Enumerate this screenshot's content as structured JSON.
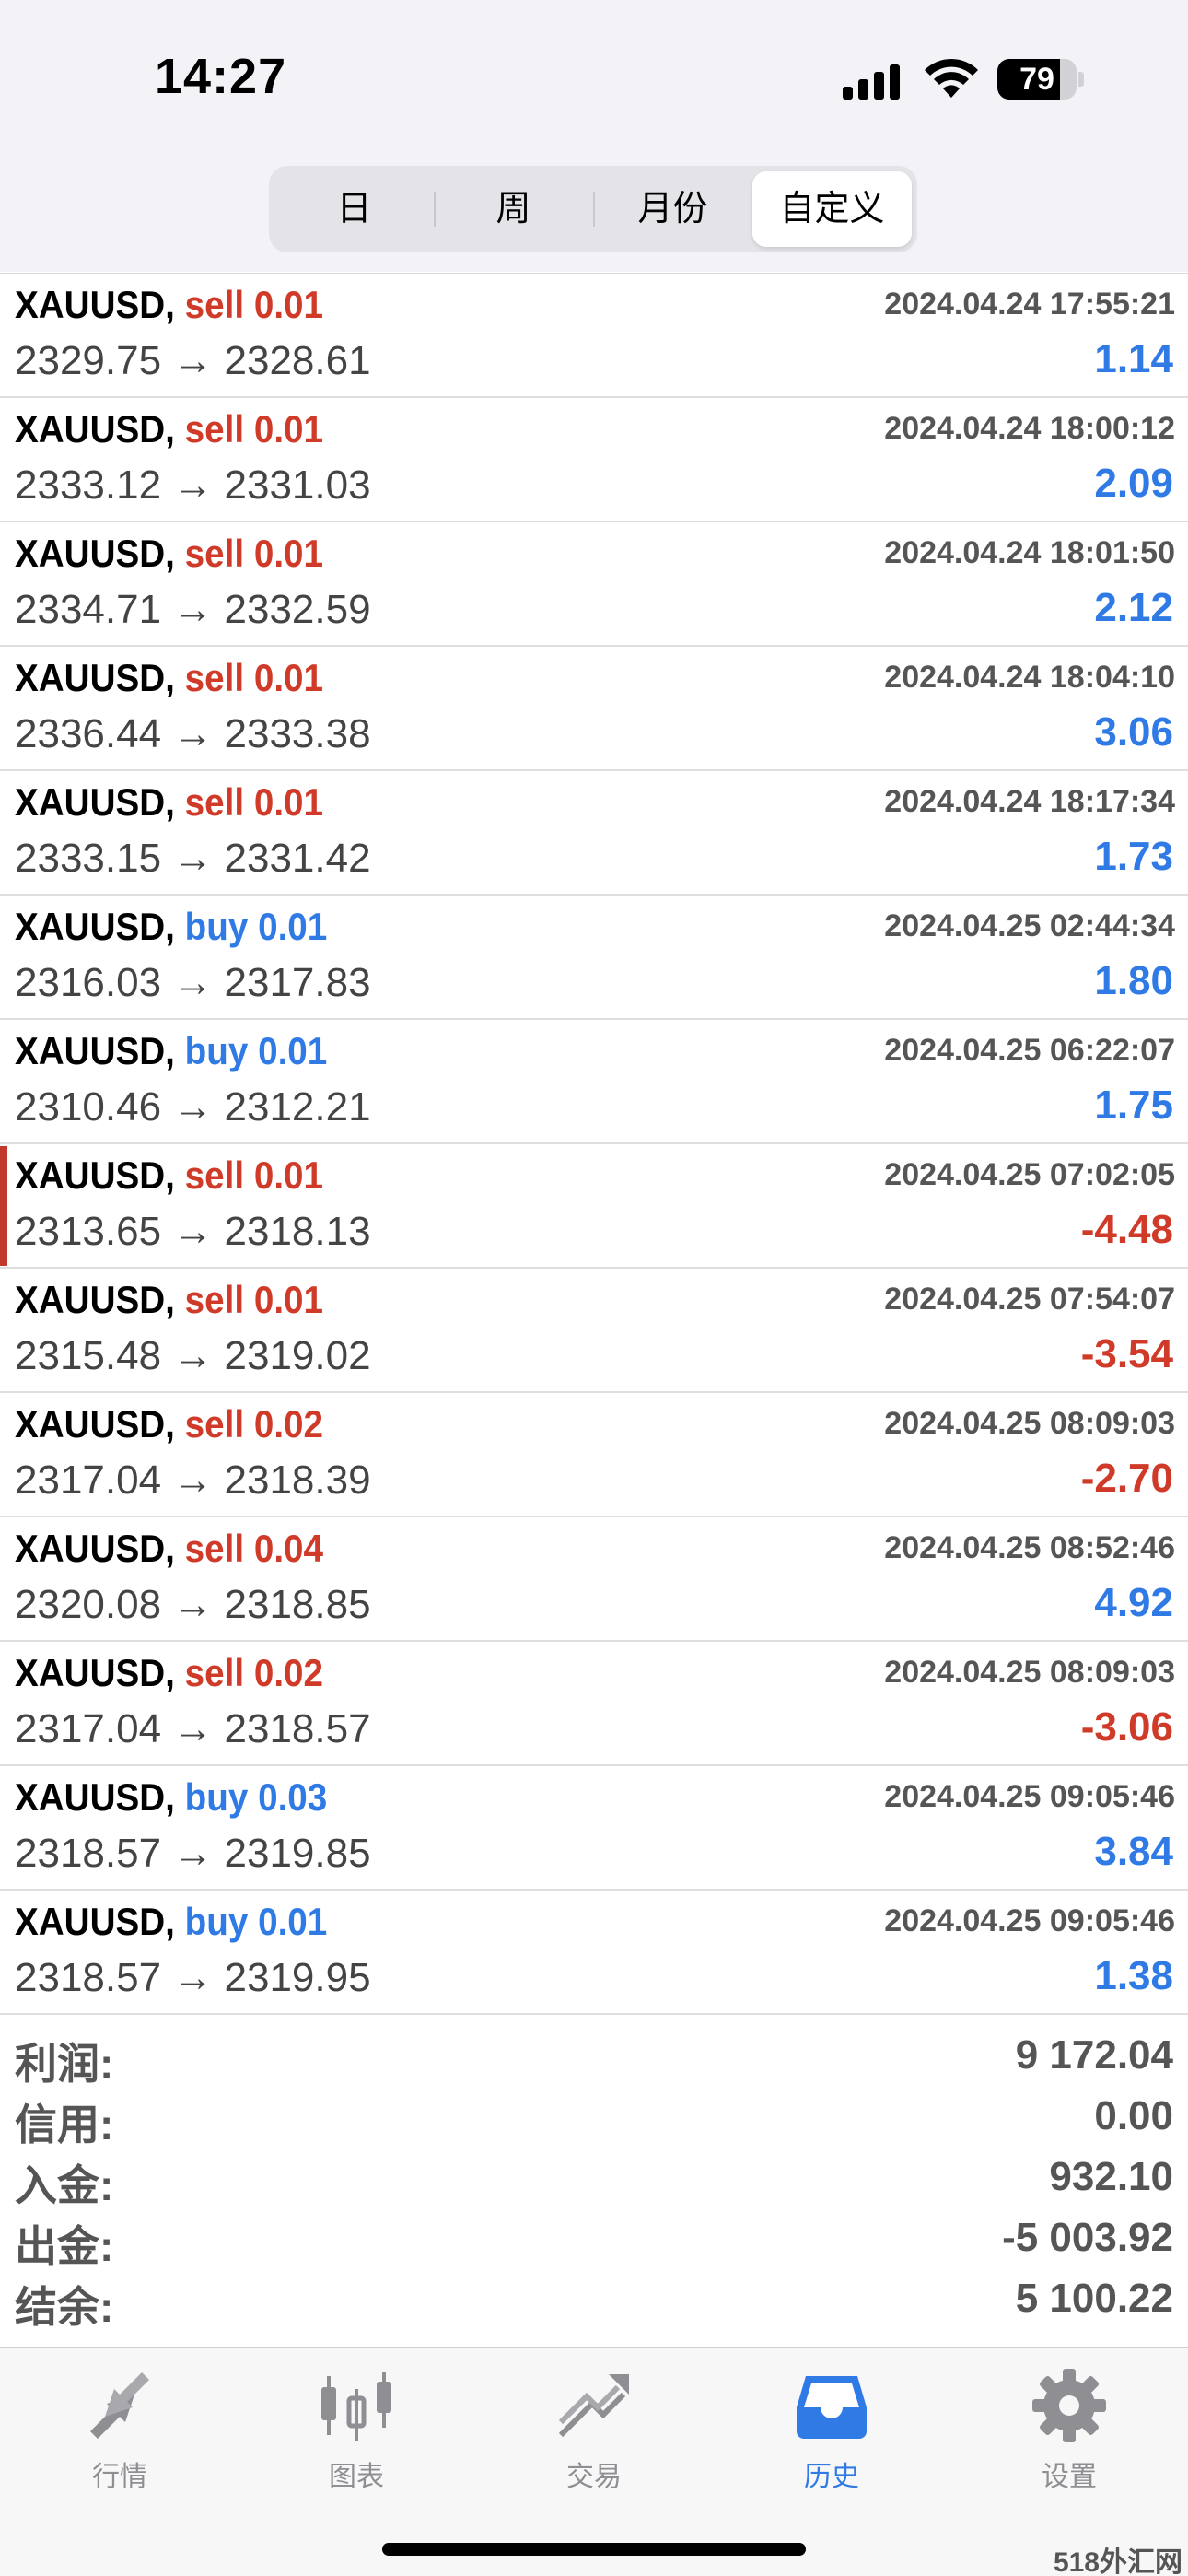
{
  "status_bar": {
    "time": "14:27",
    "battery": "79",
    "battery_level": 0.79
  },
  "segments": [
    "日",
    "周",
    "月份",
    "自定义"
  ],
  "active_segment": "自定义",
  "trades": [
    {
      "symbol": "XAUUSD,",
      "side": "sell 0.01",
      "type": "sell",
      "time": "2024.04.24 17:55:21",
      "prices": "2329.75 → 2328.61",
      "profit": "1.14",
      "sign": "pos"
    },
    {
      "symbol": "XAUUSD,",
      "side": "sell 0.01",
      "type": "sell",
      "time": "2024.04.24 18:00:12",
      "prices": "2333.12 → 2331.03",
      "profit": "2.09",
      "sign": "pos"
    },
    {
      "symbol": "XAUUSD,",
      "side": "sell 0.01",
      "type": "sell",
      "time": "2024.04.24 18:01:50",
      "prices": "2334.71 → 2332.59",
      "profit": "2.12",
      "sign": "pos"
    },
    {
      "symbol": "XAUUSD,",
      "side": "sell 0.01",
      "type": "sell",
      "time": "2024.04.24 18:04:10",
      "prices": "2336.44 → 2333.38",
      "profit": "3.06",
      "sign": "pos"
    },
    {
      "symbol": "XAUUSD,",
      "side": "sell 0.01",
      "type": "sell",
      "time": "2024.04.24 18:17:34",
      "prices": "2333.15 → 2331.42",
      "profit": "1.73",
      "sign": "pos"
    },
    {
      "symbol": "XAUUSD,",
      "side": "buy 0.01",
      "type": "buy",
      "time": "2024.04.25 02:44:34",
      "prices": "2316.03 → 2317.83",
      "profit": "1.80",
      "sign": "pos"
    },
    {
      "symbol": "XAUUSD,",
      "side": "buy 0.01",
      "type": "buy",
      "time": "2024.04.25 06:22:07",
      "prices": "2310.46 → 2312.21",
      "profit": "1.75",
      "sign": "pos"
    },
    {
      "symbol": "XAUUSD,",
      "side": "sell 0.01",
      "type": "sell",
      "time": "2024.04.25 07:02:05",
      "prices": "2313.65 → 2318.13",
      "profit": "-4.48",
      "sign": "neg",
      "marked": true
    },
    {
      "symbol": "XAUUSD,",
      "side": "sell 0.01",
      "type": "sell",
      "time": "2024.04.25 07:54:07",
      "prices": "2315.48 → 2319.02",
      "profit": "-3.54",
      "sign": "neg"
    },
    {
      "symbol": "XAUUSD,",
      "side": "sell 0.02",
      "type": "sell",
      "time": "2024.04.25 08:09:03",
      "prices": "2317.04 → 2318.39",
      "profit": "-2.70",
      "sign": "neg"
    },
    {
      "symbol": "XAUUSD,",
      "side": "sell 0.04",
      "type": "sell",
      "time": "2024.04.25 08:52:46",
      "prices": "2320.08 → 2318.85",
      "profit": "4.92",
      "sign": "pos"
    },
    {
      "symbol": "XAUUSD,",
      "side": "sell 0.02",
      "type": "sell",
      "time": "2024.04.25 08:09:03",
      "prices": "2317.04 → 2318.57",
      "profit": "-3.06",
      "sign": "neg"
    },
    {
      "symbol": "XAUUSD,",
      "side": "buy 0.03",
      "type": "buy",
      "time": "2024.04.25 09:05:46",
      "prices": "2318.57 → 2319.85",
      "profit": "3.84",
      "sign": "pos"
    },
    {
      "symbol": "XAUUSD,",
      "side": "buy 0.01",
      "type": "buy",
      "time": "2024.04.25 09:05:46",
      "prices": "2318.57 → 2319.95",
      "profit": "1.38",
      "sign": "pos"
    }
  ],
  "summary": [
    {
      "label": "利润:",
      "value": "9 172.04"
    },
    {
      "label": "信用:",
      "value": "0.00"
    },
    {
      "label": "入金:",
      "value": "932.10"
    },
    {
      "label": "出金:",
      "value": "-5 003.92"
    },
    {
      "label": "结余:",
      "value": "5 100.22"
    }
  ],
  "tabs": [
    {
      "label": "行情",
      "icon": "quotes-icon"
    },
    {
      "label": "图表",
      "icon": "chart-icon"
    },
    {
      "label": "交易",
      "icon": "trade-icon"
    },
    {
      "label": "历史",
      "icon": "history-icon",
      "active": true
    },
    {
      "label": "设置",
      "icon": "settings-icon"
    }
  ],
  "watermark": "518外汇网",
  "colors": {
    "sell": "#d03a28",
    "buy": "#2f7ae5",
    "negative": "#d03a28",
    "positive": "#2f7ae5",
    "tab_inactive": "#8e8e93",
    "tab_active": "#2f7ae5"
  }
}
